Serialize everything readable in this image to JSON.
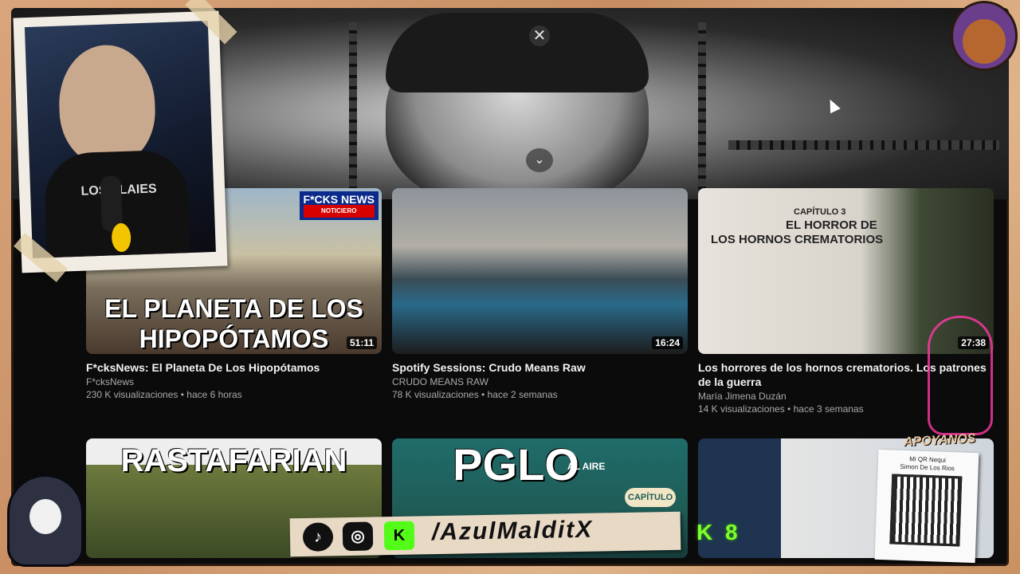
{
  "player": {
    "close_icon": "✕",
    "expand_icon": "⌄"
  },
  "videos": [
    {
      "title": "F*cksNews: El Planeta De Los Hipopótamos",
      "channel": "F*cksNews",
      "meta": "230 K visualizaciones • hace 6 horas",
      "duration": "51:11",
      "thumb_text": "EL PLANETA DE LOS HIPOPÓTAMOS",
      "badge_top": "F*CKS NEWS",
      "badge_bottom": "NOTICIERO"
    },
    {
      "title": "Spotify Sessions: Crudo Means Raw",
      "channel": "CRUDO MEANS RAW",
      "meta": "78 K visualizaciones • hace 2 semanas",
      "duration": "16:24"
    },
    {
      "title": "Los horrores de los hornos crematorios. Los patrones de la guerra",
      "channel": "María Jimena Duzán",
      "meta": "14 K visualizaciones • hace 3 semanas",
      "duration": "27:38",
      "thumb_text_1": "CAPÍTULO 3",
      "thumb_text_2": "EL HORROR DE",
      "thumb_text_3": "LOS HORNOS CREMATORIOS"
    }
  ],
  "row2": [
    {
      "thumb_text": "RASTAFARIAN"
    },
    {
      "thumb_text": "PGLO",
      "sub": "AL AIRE",
      "chapter": "CAPÍTULO"
    },
    {
      "thumb_text": ""
    }
  ],
  "overlay": {
    "shirt_text": "LOS PLAIES",
    "social_handle": "/AzulMalditX",
    "tiktok": "♪",
    "instagram": "◎",
    "kick": "K",
    "k8": "K 8",
    "apoyanos": "APOYANOS",
    "qr_line_1": "Mi QR Nequi",
    "qr_line_2": "Simon De Los Rios"
  }
}
